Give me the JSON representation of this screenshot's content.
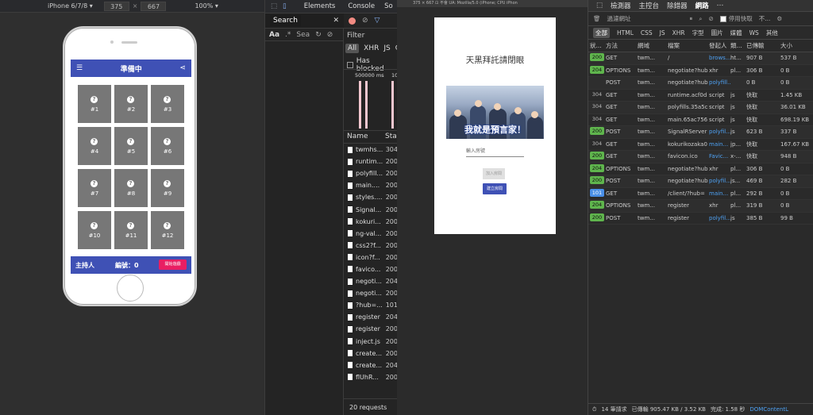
{
  "device_toolbar": {
    "device": "iPhone 6/7/8 ▾",
    "width": "375",
    "x": "×",
    "height": "667",
    "zoom": "100% ▾"
  },
  "app": {
    "title": "準備中",
    "tiles": [
      "#1",
      "#2",
      "#3",
      "#4",
      "#5",
      "#6",
      "#7",
      "#8",
      "#9",
      "#10",
      "#11",
      "#12"
    ],
    "tile_icon": "?",
    "host_label": "主持人",
    "code_label": "編號：0",
    "start_button": "開始遊戲"
  },
  "devtools": {
    "tabs": [
      "Elements",
      "Console",
      "So"
    ],
    "search_label": "Search",
    "search_opts": [
      "Aa",
      ".*",
      "Sea"
    ],
    "filter_label": "Filter",
    "filter_types": [
      "All",
      "XHR",
      "JS",
      "C"
    ],
    "has_blocked": "Has blocked",
    "timeline_labels": [
      "500000 ms",
      "10"
    ],
    "columns": [
      "Name",
      "Sta"
    ],
    "requests": [
      {
        "name": "twmhs...",
        "status": "304"
      },
      {
        "name": "runtim...",
        "status": "200"
      },
      {
        "name": "polyfill...",
        "status": "200"
      },
      {
        "name": "main....",
        "status": "200"
      },
      {
        "name": "styles....",
        "status": "200"
      },
      {
        "name": "Signal...",
        "status": "200"
      },
      {
        "name": "kokuri...",
        "status": "200"
      },
      {
        "name": "ng-val...",
        "status": "200"
      },
      {
        "name": "css2?f...",
        "status": "200"
      },
      {
        "name": "icon?f...",
        "status": "200"
      },
      {
        "name": "favico...",
        "status": "200"
      },
      {
        "name": "negoti...",
        "status": "204"
      },
      {
        "name": "negoti...",
        "status": "200"
      },
      {
        "name": "?hub=...",
        "status": "101"
      },
      {
        "name": "register",
        "status": "204"
      },
      {
        "name": "register",
        "status": "200"
      },
      {
        "name": "inject.js",
        "status": "200"
      },
      {
        "name": "create...",
        "status": "200"
      },
      {
        "name": "create...",
        "status": "204"
      },
      {
        "name": "flUhR...",
        "status": "200"
      }
    ],
    "request_count": "20 requests"
  },
  "simulator": {
    "bar_text": "375 × 667 ⊡ 不會 UA: Mozilla/5.0 (iPhone; CPU iPhon",
    "title": "天黑拜託請閉眼",
    "image_caption": "我就是預言家！",
    "input_placeholder": "輸入房號",
    "join_button": "加入房間",
    "create_button": "建立房間"
  },
  "inspector": {
    "tabs": [
      "檢測器",
      "主控台",
      "除錯器",
      "網路"
    ],
    "active_tab": "網路",
    "filter_placeholder": "過濾網址",
    "disable_cache": "停用快取",
    "throttle": "不...",
    "types": [
      "全部",
      "HTML",
      "CSS",
      "JS",
      "XHR",
      "字型",
      "圖片",
      "媒體",
      "WS",
      "其他"
    ],
    "columns": [
      "狀...",
      "方法",
      "網域",
      "檔案",
      "發起人",
      "類...",
      "已傳輸",
      "大小"
    ],
    "rows": [
      {
        "status": "200",
        "method": "GET",
        "domain": "twm...",
        "file": "/",
        "initiator": "brows...",
        "type": "ht...",
        "transferred": "907 B",
        "size": "537 B"
      },
      {
        "status": "204",
        "method": "OPTIONS",
        "domain": "twm...",
        "file": "negotiate?hub",
        "initiator": "xhr",
        "type": "pl...",
        "transferred": "306 B",
        "size": "0 B"
      },
      {
        "status": "",
        "method": "POST",
        "domain": "twm...",
        "file": "negotiate?hub",
        "initiator": "polyfill...",
        "type": "",
        "transferred": "0 B",
        "size": "0 B"
      },
      {
        "status": "304",
        "method": "GET",
        "domain": "twm...",
        "file": "runtime.acf0d",
        "initiator": "script",
        "type": "js",
        "transferred": "快取",
        "size": "1.45 KB"
      },
      {
        "status": "304",
        "method": "GET",
        "domain": "twm...",
        "file": "polyfills.35a5c",
        "initiator": "script",
        "type": "js",
        "transferred": "快取",
        "size": "36.01 KB"
      },
      {
        "status": "304",
        "method": "GET",
        "domain": "twm...",
        "file": "main.65ac756",
        "initiator": "script",
        "type": "js",
        "transferred": "快取",
        "size": "698.19 KB"
      },
      {
        "status": "200",
        "method": "POST",
        "domain": "twm...",
        "file": "SignalRServer",
        "initiator": "polyfil...",
        "type": "js",
        "transferred": "623 B",
        "size": "337 B"
      },
      {
        "status": "304",
        "method": "GET",
        "domain": "twm...",
        "file": "kokurikozaka0",
        "initiator": "main...",
        "type": "jp...",
        "transferred": "快取",
        "size": "167.67 KB"
      },
      {
        "status": "200",
        "method": "GET",
        "domain": "twm...",
        "file": "favicon.ico",
        "initiator": "Favic...",
        "type": "x-...",
        "transferred": "快取",
        "size": "948 B"
      },
      {
        "status": "204",
        "method": "OPTIONS",
        "domain": "twm...",
        "file": "negotiate?hub",
        "initiator": "xhr",
        "type": "pl...",
        "transferred": "306 B",
        "size": "0 B"
      },
      {
        "status": "200",
        "method": "POST",
        "domain": "twm...",
        "file": "negotiate?hub",
        "initiator": "polyfil...",
        "type": "js...",
        "transferred": "469 B",
        "size": "282 B"
      },
      {
        "status": "101",
        "method": "GET",
        "domain": "twm...",
        "file": "/client/?hub=",
        "initiator": "main...",
        "type": "pl...",
        "transferred": "292 B",
        "size": "0 B"
      },
      {
        "status": "204",
        "method": "OPTIONS",
        "domain": "twm...",
        "file": "register",
        "initiator": "xhr",
        "type": "pl...",
        "transferred": "319 B",
        "size": "0 B"
      },
      {
        "status": "200",
        "method": "POST",
        "domain": "twm...",
        "file": "register",
        "initiator": "polyfil...",
        "type": "js",
        "transferred": "385 B",
        "size": "99 B"
      }
    ],
    "status_bar": [
      "14 筆請求",
      "已傳輸 905.47 KB / 3.52 KB",
      "完成: 1.58 秒",
      "DOMContentL"
    ]
  }
}
